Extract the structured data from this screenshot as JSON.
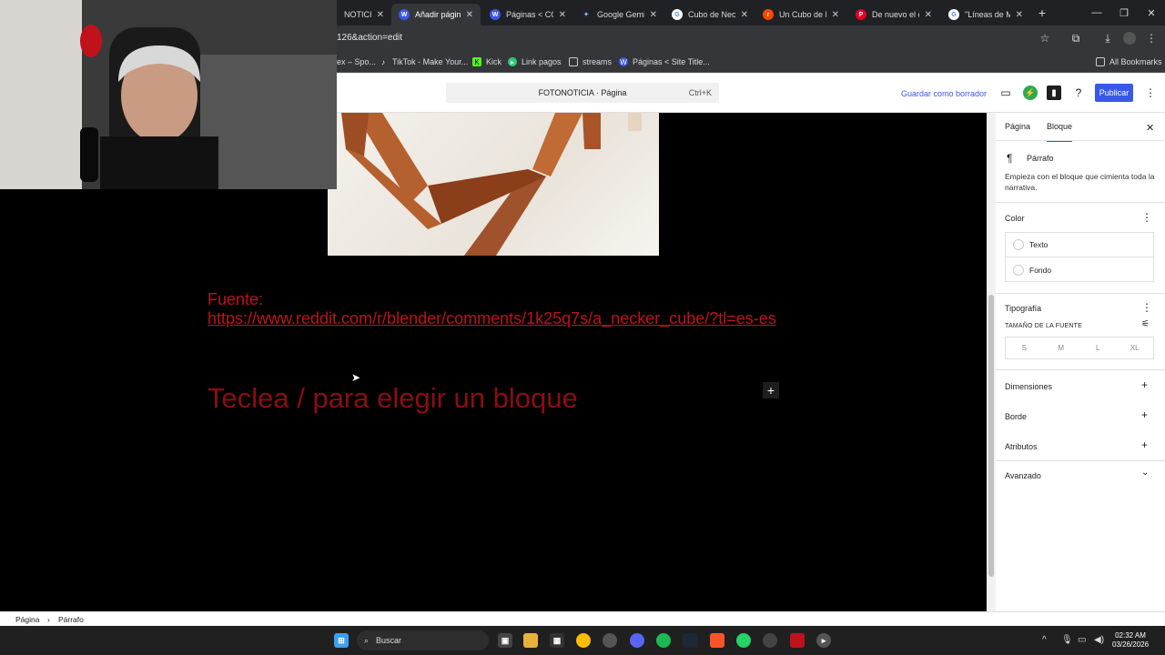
{
  "browser": {
    "tabs": [
      {
        "label": "NOTICIA",
        "icon": "wordpress-icon",
        "color": "#4a4a4a"
      },
      {
        "label": "Añadir página",
        "icon": "wordpress-icon",
        "color": "#3858e9",
        "active": true
      },
      {
        "label": "Páginas < CON",
        "icon": "wordpress-icon",
        "color": "#3858e9"
      },
      {
        "label": "Google Gemini",
        "icon": "gemini-icon",
        "color": "#8ab4f8"
      },
      {
        "label": "Cubo de Necke",
        "icon": "google-icon",
        "color": "#5f6368"
      },
      {
        "label": "Un Cubo de N",
        "icon": "reddit-icon",
        "color": "#ff4500"
      },
      {
        "label": "De nuevo el cu",
        "icon": "pinterest-icon",
        "color": "#e60023"
      },
      {
        "label": "\"Líneas de Mü",
        "icon": "google-icon",
        "color": "#5f6368"
      }
    ],
    "url": "126&action=edit",
    "bookmarks": [
      {
        "label": "ex – Spo..."
      },
      {
        "label": "TikTok - Make Your..."
      },
      {
        "label": "Kick"
      },
      {
        "label": "Link pagos"
      },
      {
        "label": "streams"
      },
      {
        "label": "Páginas < Site Title..."
      }
    ],
    "all_bookmarks": "All Bookmarks"
  },
  "editor": {
    "command_title": "FOTONOTICIA · Página",
    "command_shortcut": "Ctrl+K",
    "save_draft": "Guardar como borrador",
    "publish": "Publicar"
  },
  "content": {
    "fuente_label": "Fuente:",
    "fuente_link": "https://www.reddit.com/r/blender/comments/1k25q7s/a_necker_cube/?tl=es-es",
    "placeholder": "Teclea / para elegir un bloque"
  },
  "sidebar": {
    "tab_page": "Página",
    "tab_block": "Bloque",
    "block_name": "Párrafo",
    "block_desc": "Empieza con el bloque que cimienta toda la narrativa.",
    "color_title": "Color",
    "color_text": "Texto",
    "color_bg": "Fondo",
    "typography_title": "Tipografía",
    "font_size_label": "TAMAÑO DE LA FUENTE",
    "sizes": [
      "S",
      "M",
      "L",
      "XL"
    ],
    "dimensions": "Dimensiones",
    "border": "Borde",
    "attributes": "Atributos",
    "advanced": "Avanzado"
  },
  "breadcrumb": [
    "Página",
    "Párrafo"
  ],
  "taskbar": {
    "search_placeholder": "Buscar",
    "time": "02:32 AM",
    "date": "03/26/2026"
  },
  "colors": {
    "accent": "#3858e9",
    "red_text": "#c0121b"
  }
}
